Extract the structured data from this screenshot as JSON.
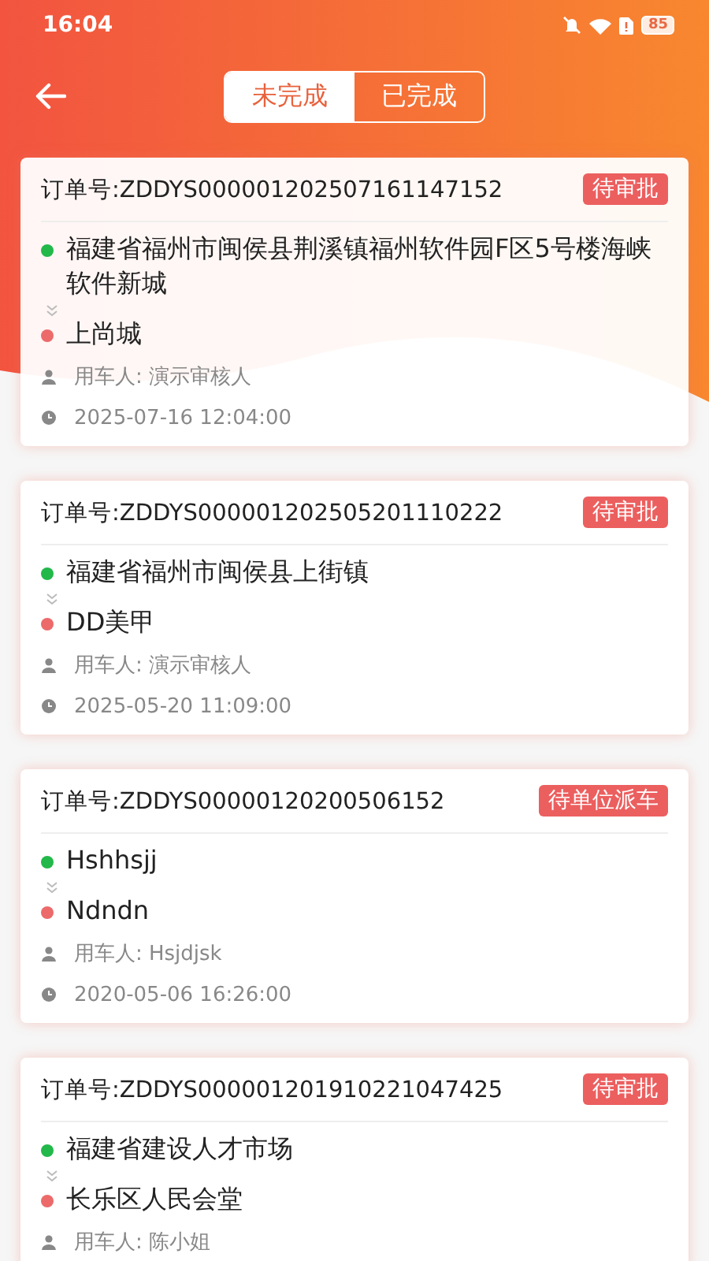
{
  "status_bar": {
    "time": "16:04",
    "battery": "85"
  },
  "header": {
    "tabs": [
      {
        "label": "未完成",
        "selected": true
      },
      {
        "label": "已完成",
        "selected": false
      }
    ]
  },
  "orders": [
    {
      "number": "订单号:ZDDYS000001202507161147152",
      "status": "待审批",
      "from": "福建省福州市闽侯县荆溪镇福州软件园F区5号楼海峡软件新城",
      "to": "上尚城",
      "user": "用车人: 演示审核人",
      "time": "2025-07-16 12:04:00"
    },
    {
      "number": "订单号:ZDDYS000001202505201110222",
      "status": "待审批",
      "from": "福建省福州市闽侯县上街镇",
      "to": "DD美甲",
      "user": "用车人: 演示审核人",
      "time": "2025-05-20 11:09:00"
    },
    {
      "number": "订单号:ZDDYS00000120200506152",
      "status": "待单位派车",
      "from": "Hshhsjj",
      "to": "Ndndn",
      "user": "用车人: Hsjdjsk",
      "time": "2020-05-06 16:26:00"
    },
    {
      "number": "订单号:ZDDYS000001201910221047425",
      "status": "待审批",
      "from": "福建省建设人才市场",
      "to": "长乐区人民会堂",
      "user": "用车人: 陈小姐"
    }
  ]
}
